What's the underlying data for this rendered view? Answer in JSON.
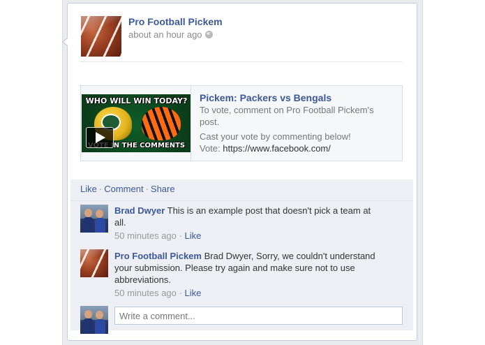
{
  "post": {
    "author": "Pro Football Pickem",
    "time": "about an hour ago",
    "privacy_icon": "globe-icon"
  },
  "attachment": {
    "thumbnail_top": "WHO WILL WIN TODAY?",
    "thumbnail_bottom": "VOTE IN THE COMMENTS",
    "title": "Pickem: Packers vs Bengals",
    "line1": "To vote, comment on Pro Football Pickem's post.",
    "line2": "Cast your vote by commenting below!",
    "url_label": "Vote: ",
    "url": "https://www.facebook.com/"
  },
  "actions": {
    "like": "Like",
    "comment": "Comment",
    "share": "Share",
    "separator": "·"
  },
  "comments": [
    {
      "author": "Brad Dwyer",
      "text": "This is an example post that doesn't pick a team at all.",
      "time": "50 minutes ago",
      "like": "Like"
    },
    {
      "author": "Pro Football Pickem",
      "text": "Brad Dwyer, Sorry, we couldn't understand your submission. Please try again and make sure not to use abbreviations.",
      "time": "50 minutes ago",
      "like": "Like"
    }
  ],
  "composer": {
    "placeholder": "Write a comment..."
  },
  "colors": {
    "link": "#3b5998",
    "panel": "#edeff4"
  }
}
